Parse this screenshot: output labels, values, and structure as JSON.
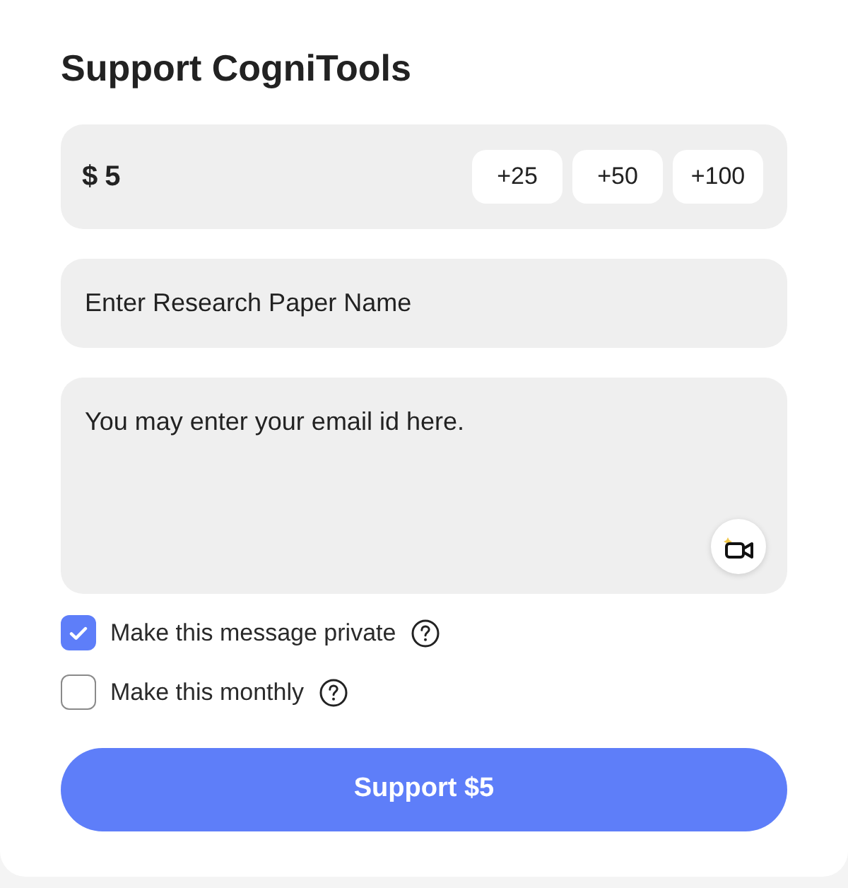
{
  "title": "Support CogniTools",
  "amount": {
    "currency": "$",
    "value": "5",
    "presets": [
      "+25",
      "+50",
      "+100"
    ]
  },
  "paper_name": {
    "placeholder": "Enter Research Paper Name"
  },
  "message": {
    "placeholder": "You may enter your email id here."
  },
  "options": [
    {
      "label": "Make this message private",
      "checked": true
    },
    {
      "label": "Make this monthly",
      "checked": false
    }
  ],
  "submit": {
    "label": "Support $5"
  }
}
